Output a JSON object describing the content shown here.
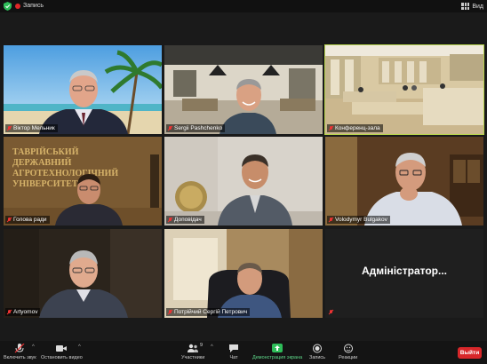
{
  "topbar": {
    "recording_label": "Запись",
    "view_label": "Вид",
    "colors": {
      "recording": "#e02828",
      "shield": "#2ebd59"
    }
  },
  "participants": [
    {
      "name": "Віктор Мельник",
      "muted": true
    },
    {
      "name": "Sergii Pashchenko",
      "muted": true
    },
    {
      "name": "Конференц-зала",
      "muted": true,
      "active_speaker": true
    },
    {
      "name": "Голова ради",
      "muted": true,
      "wall_sign": "ТАВРІЙСЬКИЙ ДЕРЖАВНИЙ АГРОТЕХНОЛОГІЧНИЙ УНІВЕРСИТЕТ"
    },
    {
      "name": "Доповідач",
      "muted": true
    },
    {
      "name": "Volodymyr Bulgakov",
      "muted": true
    },
    {
      "name": "Artyomov",
      "muted": true
    },
    {
      "name": "Потрійчий Сергій Петрович",
      "muted": true
    },
    {
      "name": "Адміністратор...",
      "muted": true,
      "video_off": true
    }
  ],
  "toolbar": {
    "mic_label": "Включить звук",
    "video_label": "Остановить видео",
    "participants_label": "Участники",
    "participants_count": "9",
    "chat_label": "Чат",
    "share_label": "Демонстрация экрана",
    "record_label": "Запись",
    "reactions_label": "Реакции",
    "leave_label": "Выйти",
    "colors": {
      "share": "#2ebd59",
      "leave": "#d8272a",
      "active_border": "#b6d34b"
    }
  }
}
